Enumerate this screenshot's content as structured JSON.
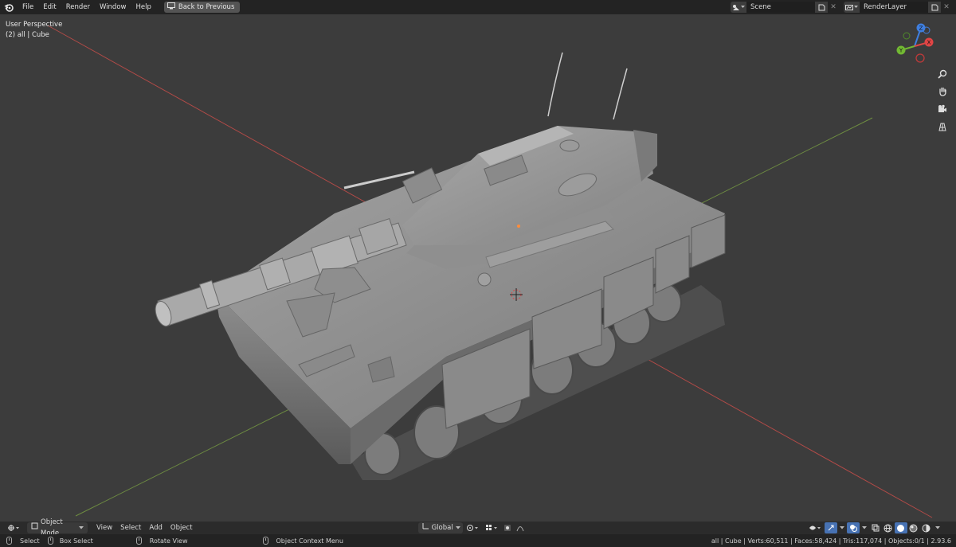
{
  "menu": {
    "items": [
      "File",
      "Edit",
      "Render",
      "Window",
      "Help"
    ],
    "back_button": "Back to Previous"
  },
  "scene": {
    "name": "Scene"
  },
  "render_layer": {
    "name": "RenderLayer"
  },
  "viewport": {
    "view_name": "User Perspective",
    "object_info": "(2) all | Cube",
    "gizmo_axes": {
      "z": "Z",
      "y": "Y",
      "x": "X"
    }
  },
  "header": {
    "mode": "Object Mode",
    "menus": [
      "View",
      "Select",
      "Add",
      "Object"
    ],
    "orientation": "Global"
  },
  "status": {
    "select": "Select",
    "box_select": "Box Select",
    "rotate_view": "Rotate View",
    "context_menu": "Object Context Menu",
    "stats": "all | Cube | Verts:60,511 | Faces:58,424 | Tris:117,074 | Objects:0/1 | 2.93.6"
  },
  "colors": {
    "viewport_bg": "#3c3c3c",
    "axis_x": "#c0504d",
    "axis_y": "#7fa34a",
    "gizmo_z": "#3f7fe0",
    "gizmo_y": "#72b833",
    "gizmo_x": "#e04545",
    "topbar": "#232323"
  }
}
